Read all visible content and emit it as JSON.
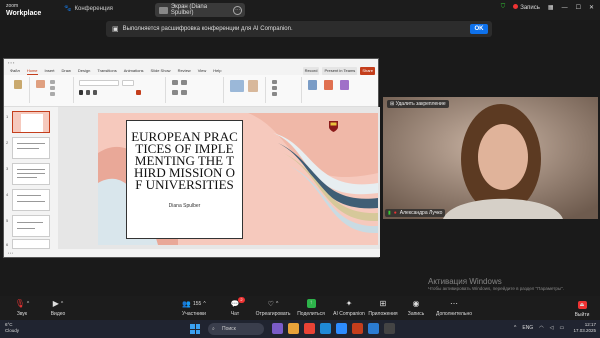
{
  "topbar": {
    "logo_line1": "zoom",
    "logo_line2": "Workplace",
    "conference_label": "Конференция",
    "share_label": "Экран (Diana Spulber)",
    "record_label": "Запись"
  },
  "banner": {
    "text": "Выполняется расшифровка конференции для AI Companion.",
    "ok_label": "OK"
  },
  "powerpoint": {
    "tabs": [
      "Файл",
      "Home",
      "Insert",
      "Draw",
      "Design",
      "Transitions",
      "Animations",
      "Slide Show",
      "Review",
      "View",
      "Help"
    ],
    "active_tab": "Home",
    "top_buttons": [
      "Record",
      "Present in Teams",
      "Share"
    ],
    "slide": {
      "title": "EUROPEAN PRACTICES OF IMPLEMENTING THE THIRD MISSION OF UNIVERSITIES",
      "author": "Diana Spulber"
    },
    "thumb_numbers": [
      "1",
      "2",
      "3",
      "4",
      "5",
      "6"
    ]
  },
  "camera": {
    "pin_label": "Удалить закрепление",
    "participant_name": "Александра Лучко"
  },
  "watermark": {
    "title": "Активация Windows",
    "subtitle": "Чтобы активировать Windows, перейдите в раздел \"Параметры\"."
  },
  "toolbar": {
    "audio_label": "Звук",
    "video_label": "Видео",
    "participants_label": "Участники",
    "participants_count": "155",
    "chat_label": "Чат",
    "chat_badge": "2",
    "react_label": "Отреагировать",
    "share_label": "Поделиться",
    "ai_label": "AI Companion",
    "apps_label": "Приложения",
    "record_label": "Запись",
    "more_label": "Дополнительно",
    "leave_label": "Выйти"
  },
  "taskbar": {
    "temperature": "6°C",
    "weather_text": "Cloudy",
    "search_placeholder": "Поиск",
    "language": "ENG",
    "time": "12:17",
    "date": "17.03.2025"
  },
  "colors": {
    "accent_blue": "#0e71eb",
    "ppt_orange": "#c43e1c",
    "record_red": "#e33333",
    "slide_pink": "#f6c9bd"
  }
}
